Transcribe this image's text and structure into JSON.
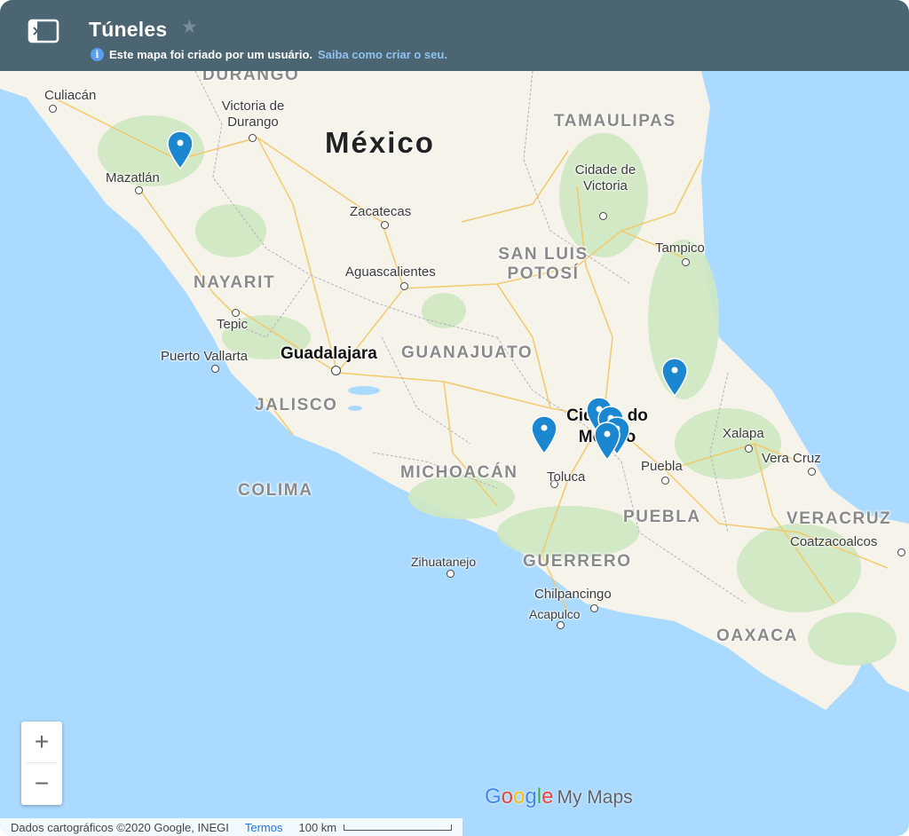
{
  "header": {
    "title": "Túneles",
    "info_text": "Este mapa foi criado por um usuário.",
    "info_link": "Saiba como criar o seu."
  },
  "map": {
    "country": "México",
    "states": [
      "DURANGO",
      "TAMAULIPAS",
      "SAN LUIS POTOSÍ",
      "NAYARIT",
      "GUANAJUATO",
      "JALISCO",
      "MICHOACÁN",
      "COLIMA",
      "PUEBLA",
      "VERACRUZ",
      "GUERRERO",
      "OAXACA"
    ],
    "cities": {
      "culiacan": "Culiacán",
      "victoria_durango": "Victoria de Durango",
      "mazatlan": "Mazatlán",
      "zacatecas": "Zacatecas",
      "aguascalientes": "Aguascalientes",
      "cd_victoria": "Cidade de Victoria",
      "tampico": "Tampico",
      "tepic": "Tepic",
      "puerto_vallarta": "Puerto Vallarta",
      "guadalajara": "Guadalajara",
      "cd_mexico": "Cidade do México",
      "toluca": "Toluca",
      "puebla": "Puebla",
      "xalapa": "Xalapa",
      "vera_cruz": "Vera Cruz",
      "coatzacoalcos": "Coatzacoalcos",
      "zihuatanejo": "Zihuatanejo",
      "chilpancingo": "Chilpancingo",
      "acapulco": "Acapulco"
    },
    "marker_color": "#1a87d0"
  },
  "controls": {
    "zoom_in": "+",
    "zoom_out": "−"
  },
  "branding": {
    "g1": "G",
    "g2": "o",
    "g3": "o",
    "g4": "g",
    "g5": "l",
    "g6": "e",
    "product": "My Maps"
  },
  "footer": {
    "attribution": "Dados cartográficos ©2020 Google, INEGI",
    "terms": "Termos",
    "scale": "100 km"
  }
}
